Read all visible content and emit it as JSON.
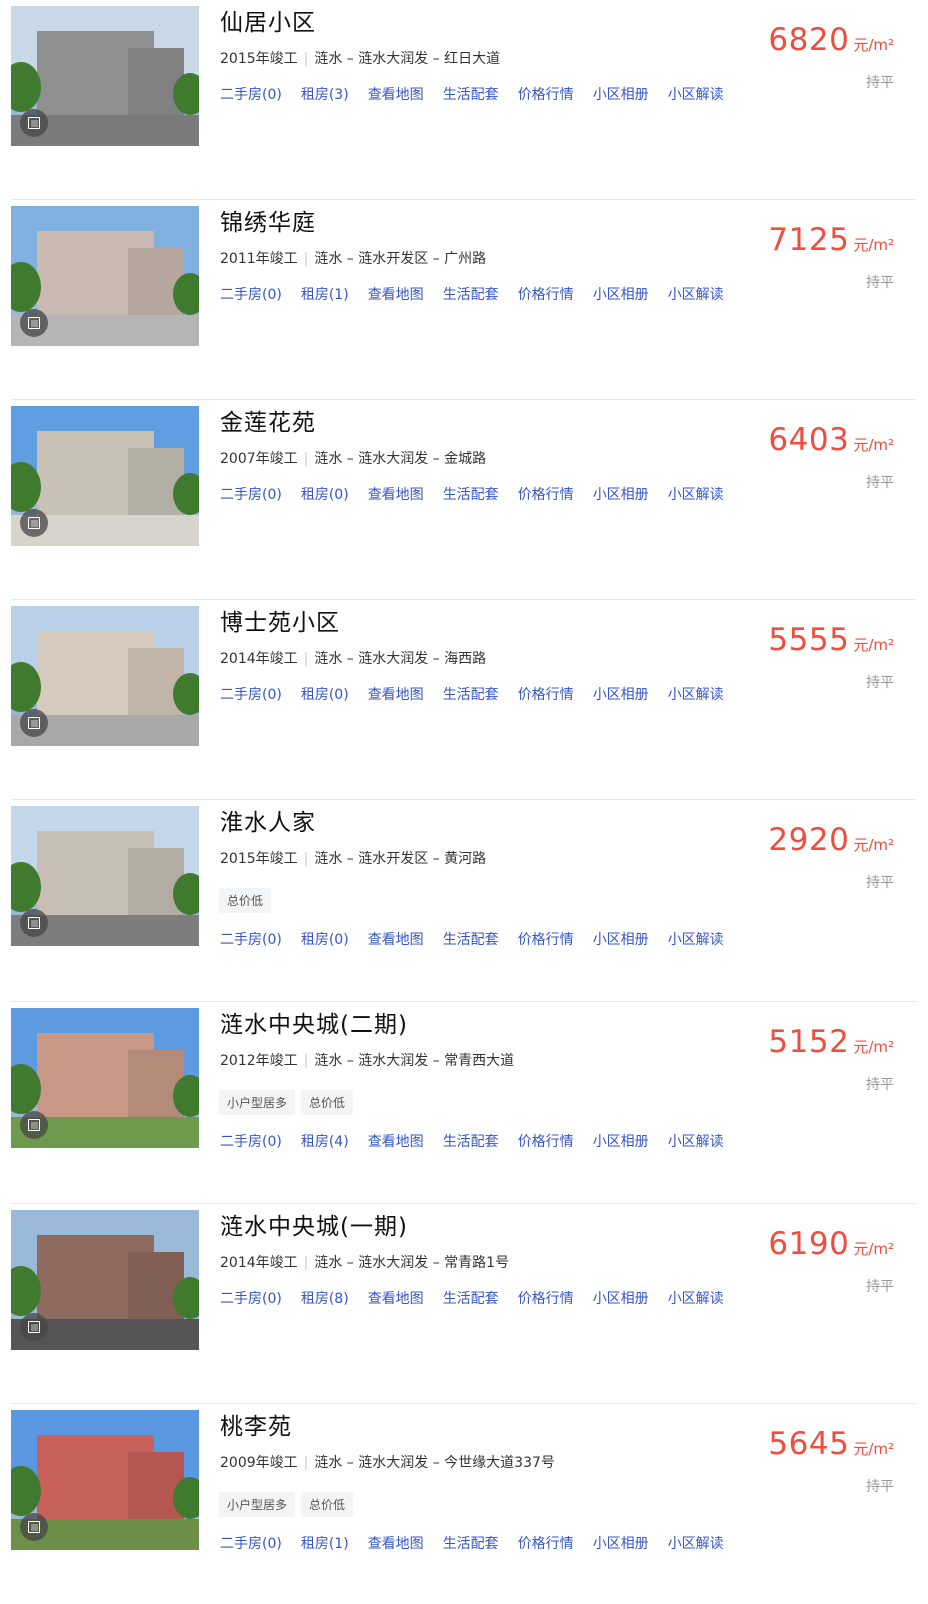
{
  "colors": {
    "price": "#ef4d3d",
    "link": "#3656c8",
    "divider": "#e9e9e9"
  },
  "items": [
    {
      "name": "仙居小区",
      "year": "2015年竣工",
      "district": "涟水",
      "area": "涟水大润发",
      "road": "红日大道",
      "tags": [],
      "links": [
        "二手房(0)",
        "租房(3)",
        "查看地图",
        "生活配套",
        "价格行情",
        "小区相册",
        "小区解读"
      ],
      "price": "6820",
      "unit": "元/m²",
      "trend": "持平"
    },
    {
      "name": "锦绣华庭",
      "year": "2011年竣工",
      "district": "涟水",
      "area": "涟水开发区",
      "road": "广州路",
      "tags": [],
      "links": [
        "二手房(0)",
        "租房(1)",
        "查看地图",
        "生活配套",
        "价格行情",
        "小区相册",
        "小区解读"
      ],
      "price": "7125",
      "unit": "元/m²",
      "trend": "持平"
    },
    {
      "name": "金莲花苑",
      "year": "2007年竣工",
      "district": "涟水",
      "area": "涟水大润发",
      "road": "金城路",
      "tags": [],
      "links": [
        "二手房(0)",
        "租房(0)",
        "查看地图",
        "生活配套",
        "价格行情",
        "小区相册",
        "小区解读"
      ],
      "price": "6403",
      "unit": "元/m²",
      "trend": "持平"
    },
    {
      "name": "博士苑小区",
      "year": "2014年竣工",
      "district": "涟水",
      "area": "涟水大润发",
      "road": "海西路",
      "tags": [],
      "links": [
        "二手房(0)",
        "租房(0)",
        "查看地图",
        "生活配套",
        "价格行情",
        "小区相册",
        "小区解读"
      ],
      "price": "5555",
      "unit": "元/m²",
      "trend": "持平"
    },
    {
      "name": "淮水人家",
      "year": "2015年竣工",
      "district": "涟水",
      "area": "涟水开发区",
      "road": "黄河路",
      "tags": [
        "总价低"
      ],
      "links": [
        "二手房(0)",
        "租房(0)",
        "查看地图",
        "生活配套",
        "价格行情",
        "小区相册",
        "小区解读"
      ],
      "price": "2920",
      "unit": "元/m²",
      "trend": "持平"
    },
    {
      "name": "涟水中央城(二期)",
      "year": "2012年竣工",
      "district": "涟水",
      "area": "涟水大润发",
      "road": "常青西大道",
      "tags": [
        "小户型居多",
        "总价低"
      ],
      "links": [
        "二手房(0)",
        "租房(4)",
        "查看地图",
        "生活配套",
        "价格行情",
        "小区相册",
        "小区解读"
      ],
      "price": "5152",
      "unit": "元/m²",
      "trend": "持平"
    },
    {
      "name": "涟水中央城(一期)",
      "year": "2014年竣工",
      "district": "涟水",
      "area": "涟水大润发",
      "road": "常青路1号",
      "tags": [],
      "links": [
        "二手房(0)",
        "租房(8)",
        "查看地图",
        "生活配套",
        "价格行情",
        "小区相册",
        "小区解读"
      ],
      "price": "6190",
      "unit": "元/m²",
      "trend": "持平"
    },
    {
      "name": "桃李苑",
      "year": "2009年竣工",
      "district": "涟水",
      "area": "涟水大润发",
      "road": "今世缘大道337号",
      "tags": [
        "小户型居多",
        "总价低"
      ],
      "links": [
        "二手房(0)",
        "租房(1)",
        "查看地图",
        "生活配套",
        "价格行情",
        "小区相册",
        "小区解读"
      ],
      "price": "5645",
      "unit": "元/m²",
      "trend": "持平"
    }
  ]
}
